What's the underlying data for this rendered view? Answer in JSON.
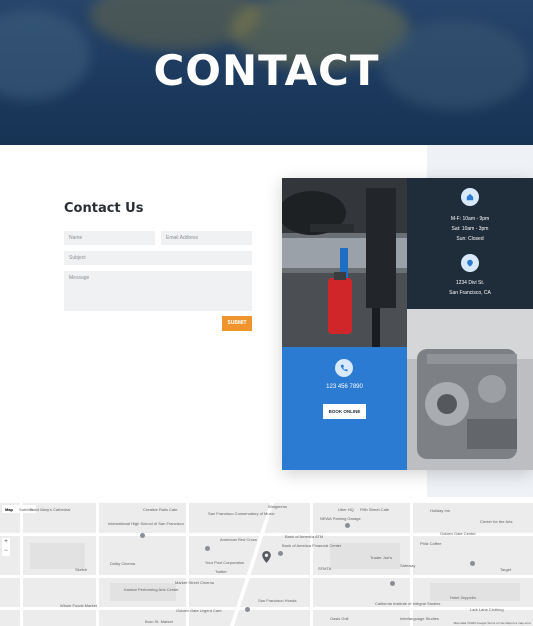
{
  "hero": {
    "title": "CONTACT"
  },
  "form": {
    "heading": "Contact Us",
    "name_placeholder": "Name",
    "email_placeholder": "Email Address",
    "subject_placeholder": "Subject",
    "message_placeholder": "Message",
    "submit_label": "SUBMIT"
  },
  "hours": {
    "line1": "M-F: 10am - 9pm",
    "line2": "Sat: 10am - 3pm",
    "line3": "Sun: Closed"
  },
  "address": {
    "line1": "1234 Divi St.",
    "line2": "San Francisco, CA"
  },
  "phone": {
    "number": "123 456 7890",
    "button_label": "BOOK ONLINE"
  },
  "map": {
    "type_map": "Map",
    "type_satellite": "Satellite",
    "zoom_in": "+",
    "zoom_out": "−",
    "labels": [
      "Creative Rails Cafe",
      "San Francisco Conservatory of Music",
      "International High School of San Francisco",
      "American Red Cross",
      "Bank of America ATM",
      "NEWA Parking Garage",
      "Philz Coffee",
      "Center for the Arts",
      "Golden Gate Center",
      "Walgreens",
      "Uber HQ",
      "Bank of America Financial Center",
      "Dolby Cinema",
      "Sketch",
      "Saint Mary's Cathedral",
      "Your Pool Corporation",
      "Twitter",
      "Market Street Cinema",
      "Kanbar Performing Arts Center",
      "Golden Gate Urgent Care",
      "Burn St. Market",
      "San Francisco Honda",
      "Trader Joe's",
      "Whole Foods Market",
      "Safeway",
      "California Institute of Integral Studies",
      "Interlanguage Studies",
      "SFMTA",
      "Holiday Inn",
      "Target",
      "Fifth Street Cafe",
      "Oasis Grill",
      "Hotel Zeppelin",
      "Lark Lane Clothing"
    ],
    "attribution": "Map data ©2023 Google  Terms of Use  Report a map error"
  },
  "colors": {
    "accent": "#f0942d",
    "hero_dark": "#1c3a5e",
    "panel_dark": "#1f2c39",
    "panel_blue": "#2b7bd3"
  },
  "icons": {
    "hours": "home-icon",
    "address": "location-pin-icon",
    "phone": "phone-icon",
    "map_marker": "map-marker-icon"
  }
}
